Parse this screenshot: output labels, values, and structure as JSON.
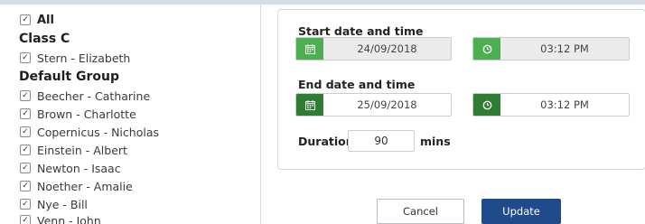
{
  "left_panel": {
    "all_label": "All",
    "groups": [
      {
        "title": "Class C",
        "people": [
          "Stern - Elizabeth"
        ]
      },
      {
        "title": "Default Group",
        "people": [
          "Beecher - Catharine",
          "Brown - Charlotte",
          "Copernicus - Nicholas",
          "Einstein - Albert",
          "Newton - Isaac",
          "Noether - Amalie",
          "Nye - Bill",
          "Venn - John"
        ]
      }
    ]
  },
  "form": {
    "start_title": "Start date and time",
    "start_date": "24/09/2018",
    "start_time": "03:12 PM",
    "end_title": "End date and time",
    "end_date": "25/09/2018",
    "end_time": "03:12 PM",
    "duration_label": "Duration",
    "duration_value": "90",
    "duration_unit": "mins"
  },
  "buttons": {
    "cancel": "Cancel",
    "update": "Update"
  },
  "icons": {
    "checkbox": "check-icon",
    "calendar": "calendar-icon",
    "clock": "clock-icon"
  },
  "colors": {
    "addon_green": "#4caf50",
    "addon_dark_green": "#2e7d32",
    "update_blue": "#1f4a8c"
  }
}
